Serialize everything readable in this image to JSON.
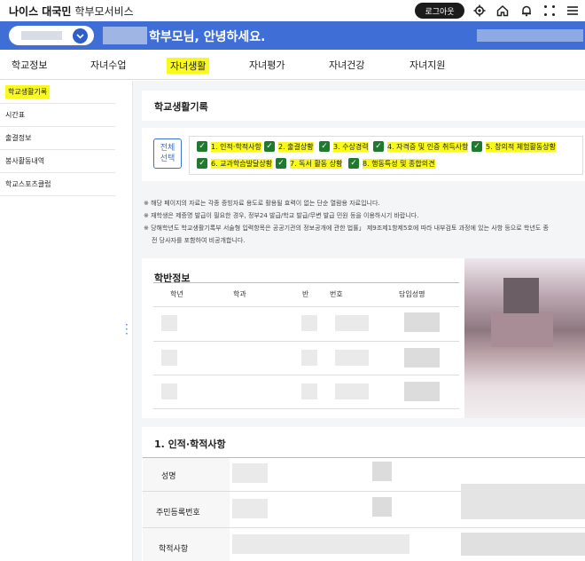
{
  "header": {
    "brand": "나이스 대국민",
    "service": "학부모서비스",
    "logout_label": "로그아웃",
    "icons": [
      "gear-icon",
      "home-icon",
      "bell-icon",
      "grid-icon"
    ]
  },
  "userbar": {
    "greeting": "학부모님, 안녕하세요."
  },
  "nav": {
    "items": [
      "학교정보",
      "자녀수업",
      "자녀생활",
      "자녀평가",
      "자녀건강",
      "자녀지원"
    ],
    "active_index": 2
  },
  "sidebar": {
    "items": [
      "학교생활기록",
      "시간표",
      "출결정보",
      "봉사활동내역",
      "학교스포츠클럽"
    ],
    "active_index": 0
  },
  "main": {
    "section_title": "학교생활기록",
    "select_all_label": "전체\n선택",
    "checkboxes": [
      "1. 인적·학적사항",
      "2. 출결상황",
      "3. 수상경력",
      "4. 자격증 및 인증 취득사항",
      "5. 창의적 체험활동상황",
      "6. 교과학습발달상황",
      "7. 독서 활동 상황",
      "8. 행동특성 및 종합의견"
    ],
    "notes": [
      "※ 해당 페이지의 자료는 각종 증빙자료 용도로 활용될 효력이 없는 단순 열람용 자료입니다.",
      "※ 재학생은 제증명 발급이 필요한 경우, 정부24 발급/학교 발급/무변 발급 민원 등을 이용하시기 바랍니다.",
      "※ 당해학년도 학교생활기록부 서술형 입력항목은 공공기관의 정보공개에 관한 법률」 제9조제1항제5호에 따라 내부검토 과정에 있는 사항 등으로 학년도 종",
      "전 당사자를 포함하여 비공개합니다."
    ],
    "class_info": {
      "title": "학반정보",
      "columns": [
        "학년",
        "학과",
        "반",
        "번호",
        "담임성명"
      ]
    },
    "personal": {
      "title": "1. 인적·학적사항",
      "rows": [
        "성명",
        "주민등록번호",
        "학적사항"
      ]
    }
  },
  "colors": {
    "accent": "#3f6fd6",
    "highlight": "#f9f91c",
    "check": "#1f7a30"
  }
}
